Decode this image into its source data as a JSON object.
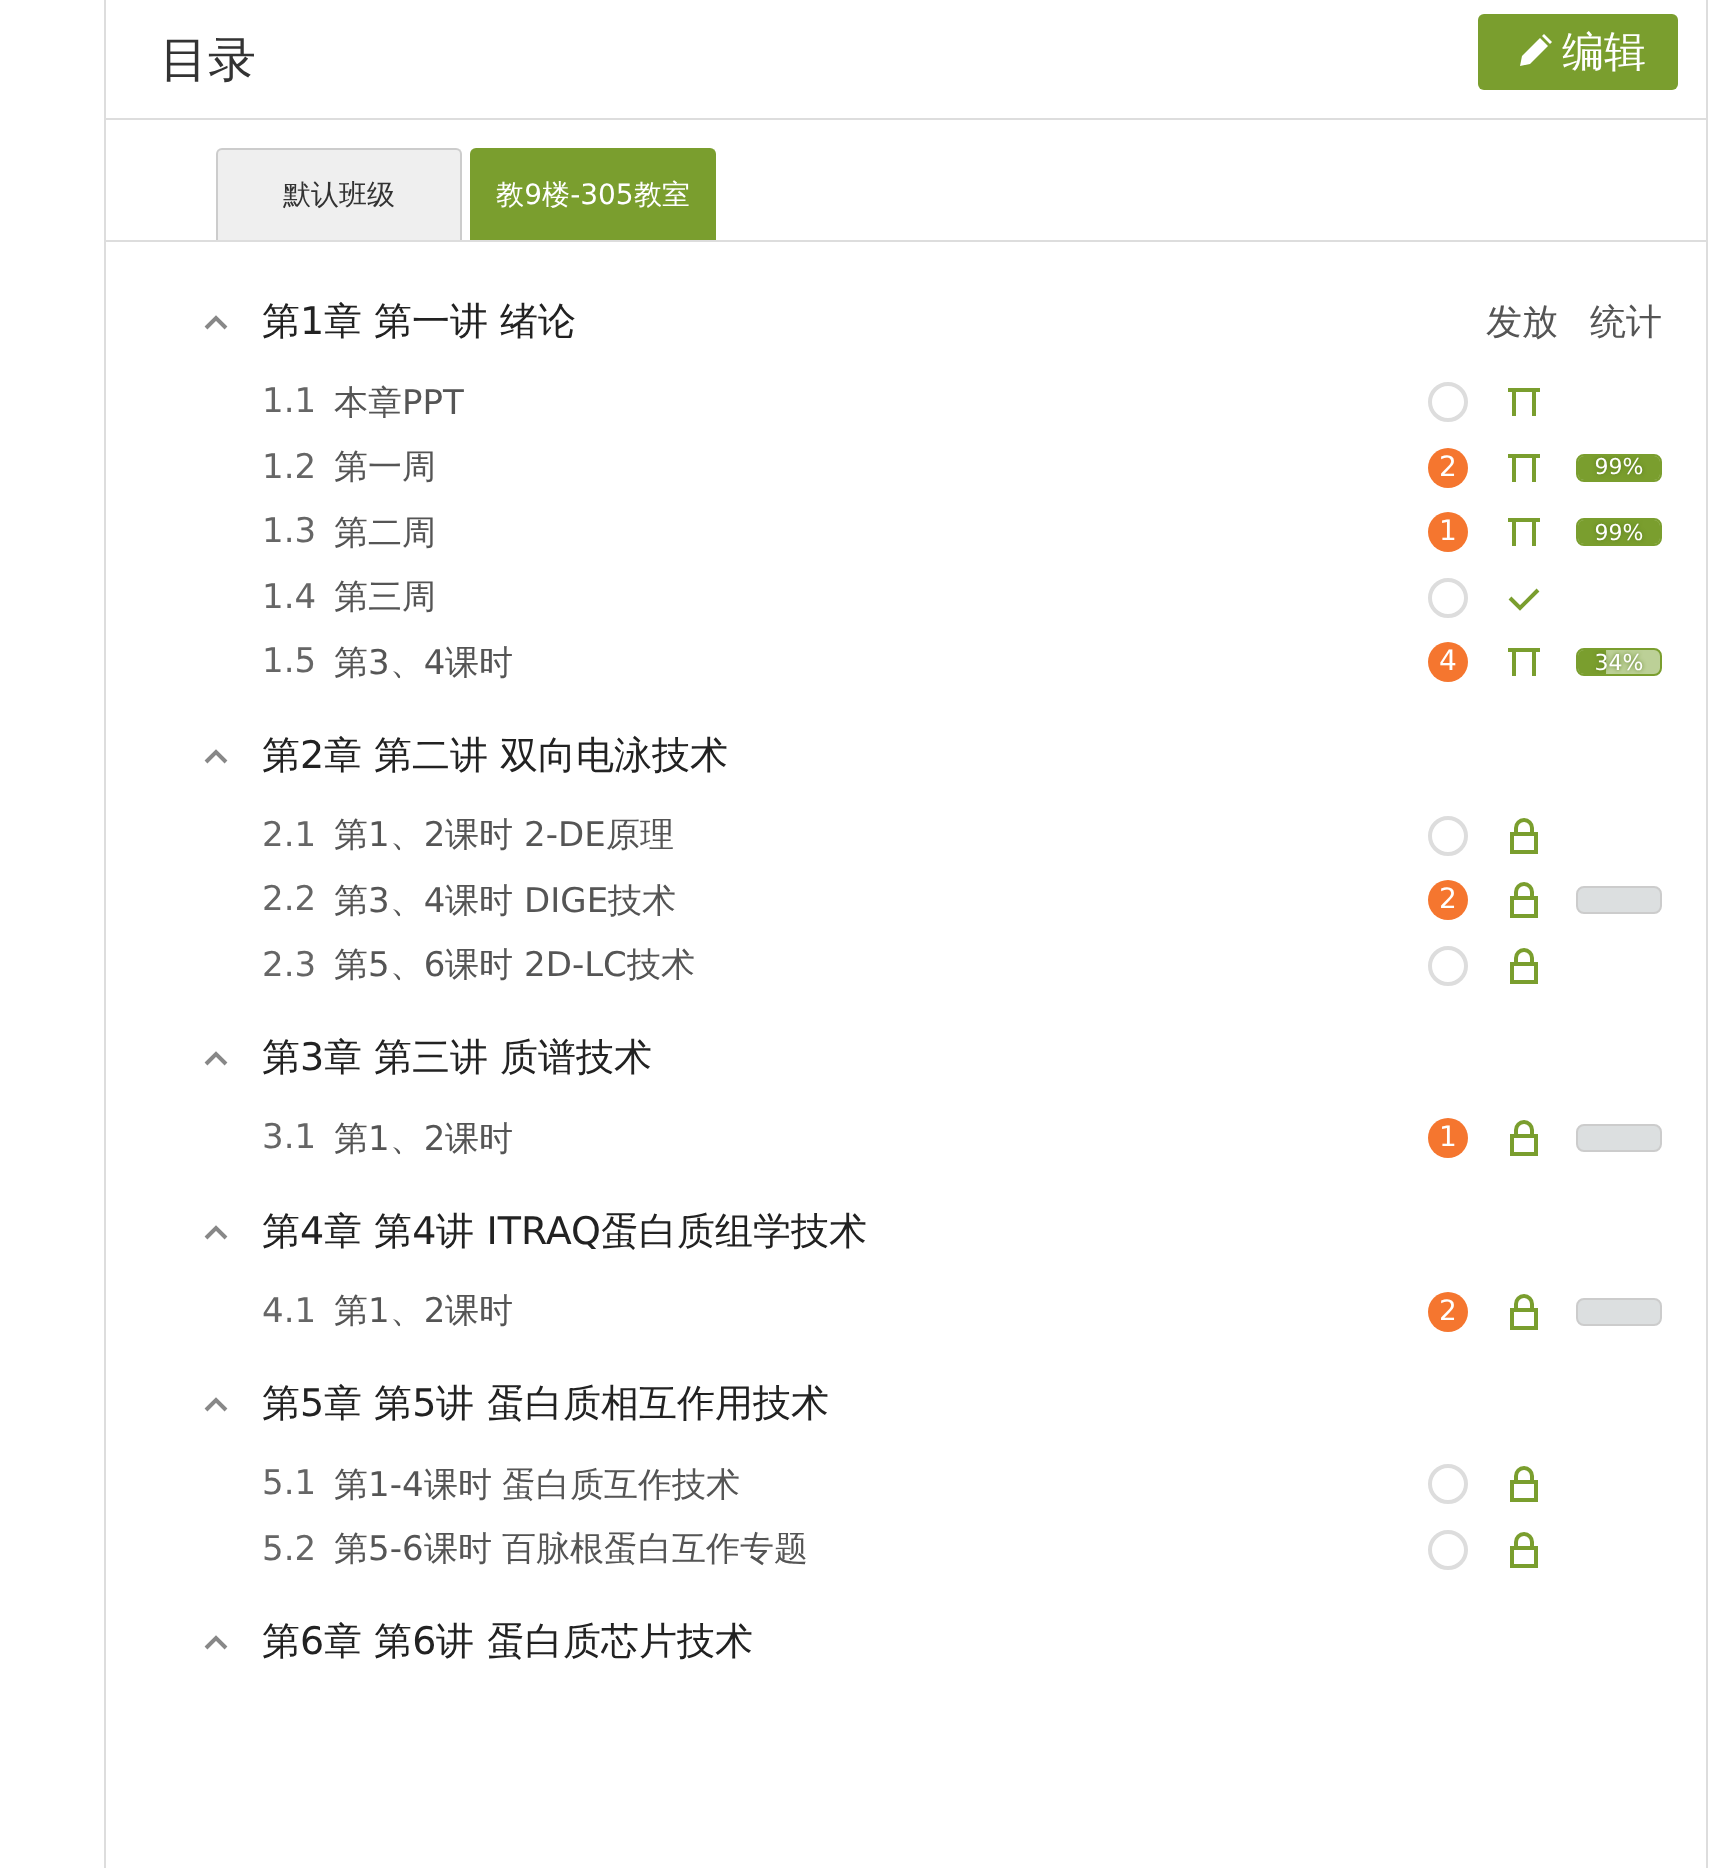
{
  "header": {
    "title": "目录",
    "edit_button": "编辑"
  },
  "tabs": [
    {
      "label": "默认班级",
      "selected": false
    },
    {
      "label": "教9楼-305教室",
      "selected": true
    }
  ],
  "columns": [
    "发放",
    "统计"
  ],
  "chapters": [
    {
      "title": "第1章 第一讲 绪论",
      "expanded": true,
      "lessons": [
        {
          "number": "1.1",
          "title": "本章PPT",
          "kind": "released"
        },
        {
          "number": "1.2",
          "title": "第一周",
          "badge": "2",
          "kind": "released",
          "stat": {
            "level": 0.99,
            "text": "99%"
          }
        },
        {
          "number": "1.3",
          "title": "第二周",
          "badge": "1",
          "kind": "released",
          "stat": {
            "level": 0.99,
            "text": "99%"
          }
        },
        {
          "number": "1.4",
          "title": "第三周",
          "kind": "done"
        },
        {
          "number": "1.5",
          "title": "第3、4课时",
          "badge": "4",
          "kind": "released",
          "stat": {
            "level": 0.34,
            "text": "34%"
          }
        }
      ]
    },
    {
      "title": "第2章 第二讲 双向电泳技术",
      "expanded": true,
      "lessons": [
        {
          "number": "2.1",
          "title": "第1、2课时 2-DE原理",
          "kind": "locked"
        },
        {
          "number": "2.2",
          "title": "第3、4课时 DIGE技术",
          "badge": "2",
          "kind": "locked",
          "stat": {
            "level": 0
          }
        },
        {
          "number": "2.3",
          "title": "第5、6课时 2D-LC技术",
          "kind": "locked"
        }
      ]
    },
    {
      "title": "第3章 第三讲 质谱技术",
      "expanded": true,
      "lessons": [
        {
          "number": "3.1",
          "title": "第1、2课时",
          "badge": "1",
          "kind": "locked",
          "stat": {
            "level": 0
          }
        }
      ]
    },
    {
      "title": "第4章 第4讲 ITRAQ蛋白质组学技术",
      "expanded": true,
      "lessons": [
        {
          "number": "4.1",
          "title": "第1、2课时",
          "badge": "2",
          "kind": "locked",
          "stat": {
            "level": 0
          }
        }
      ]
    },
    {
      "title": "第5章 第5讲 蛋白质相互作用技术",
      "expanded": true,
      "lessons": [
        {
          "number": "5.1",
          "title": "第1-4课时 蛋白质互作技术",
          "kind": "locked"
        },
        {
          "number": "5.2",
          "title": "第5-6课时 百脉根蛋白互作专题",
          "kind": "locked"
        }
      ]
    },
    {
      "title": "第6章 第6讲 蛋白质芯片技术",
      "expanded": true
    }
  ]
}
